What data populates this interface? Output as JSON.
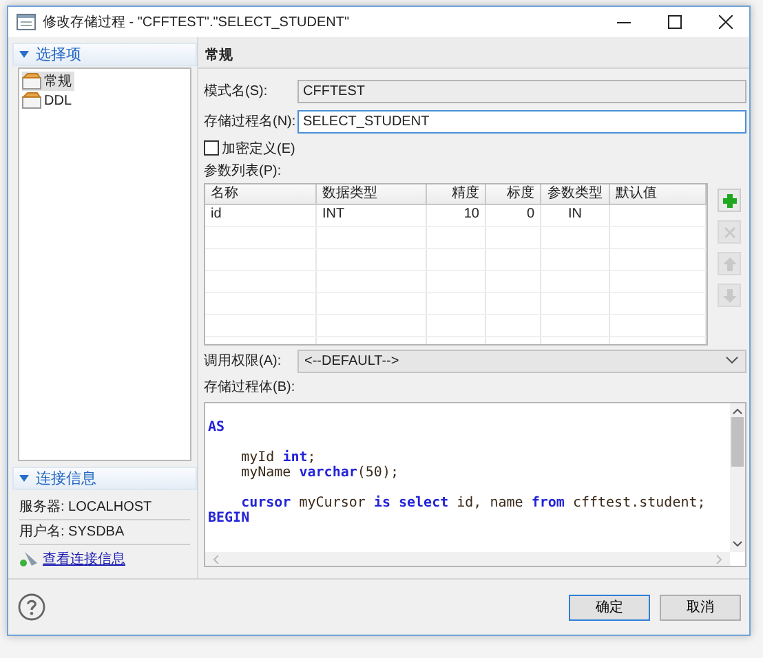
{
  "window": {
    "title": "修改存储过程 - \"CFFTEST\".\"SELECT_STUDENT\""
  },
  "sidebar": {
    "header": "选择项",
    "items": [
      {
        "label": "常规",
        "selected": true
      },
      {
        "label": "DDL",
        "selected": false
      }
    ]
  },
  "connection": {
    "header": "连接信息",
    "server": "服务器: LOCALHOST",
    "user": "用户名: SYSDBA",
    "link": "查看连接信息"
  },
  "section_title": "常规",
  "fields": [
    {
      "label": "模式名(S):",
      "value": "CFFTEST",
      "disabled": true
    },
    {
      "label": "存储过程名(N):",
      "value": "SELECT_STUDENT",
      "disabled": false
    }
  ],
  "encrypt": {
    "label": "加密定义(E)",
    "checked": false
  },
  "params": {
    "label": "参数列表(P):",
    "columns": [
      "名称",
      "数据类型",
      "精度",
      "标度",
      "参数类型",
      "默认值"
    ],
    "rows": [
      [
        "id",
        "INT",
        "10",
        "0",
        "IN"
      ]
    ],
    "tools": [
      {
        "kind": "add",
        "disabled": false
      },
      {
        "kind": "delete",
        "disabled": true
      },
      {
        "kind": "up",
        "disabled": true
      },
      {
        "kind": "down",
        "disabled": true
      }
    ]
  },
  "invoker": {
    "label": "调用权限(A):",
    "value": "<--DEFAULT-->"
  },
  "body": {
    "label": "存储过程体(B):",
    "lines": [
      {
        "kind": "blank"
      },
      {
        "kind": "code",
        "segments": [
          {
            "text": "AS",
            "kind": "keyword"
          }
        ]
      },
      {
        "kind": "blank"
      },
      {
        "kind": "code",
        "segments": [
          {
            "text": "    myId ",
            "kind": "plain"
          },
          {
            "text": "int",
            "kind": "keyword"
          },
          {
            "text": ";",
            "kind": "plain"
          }
        ]
      },
      {
        "kind": "code",
        "segments": [
          {
            "text": "    myName ",
            "kind": "plain"
          },
          {
            "text": "varchar",
            "kind": "keyword"
          },
          {
            "text": "(50);",
            "kind": "plain"
          }
        ]
      },
      {
        "kind": "blank"
      },
      {
        "kind": "code",
        "segments": [
          {
            "text": "    cursor",
            "kind": "keyword"
          },
          {
            "text": " myCursor ",
            "kind": "plain"
          },
          {
            "text": "is select",
            "kind": "keyword"
          },
          {
            "text": " id, name ",
            "kind": "plain"
          },
          {
            "text": "from",
            "kind": "keyword"
          },
          {
            "text": " cfftest.student;",
            "kind": "plain"
          }
        ]
      },
      {
        "kind": "code",
        "segments": [
          {
            "text": "BEGIN",
            "kind": "keyword"
          }
        ]
      }
    ]
  },
  "buttons": [
    {
      "label": "确定",
      "kind": "default"
    },
    {
      "label": "取消",
      "kind": "normal"
    }
  ]
}
